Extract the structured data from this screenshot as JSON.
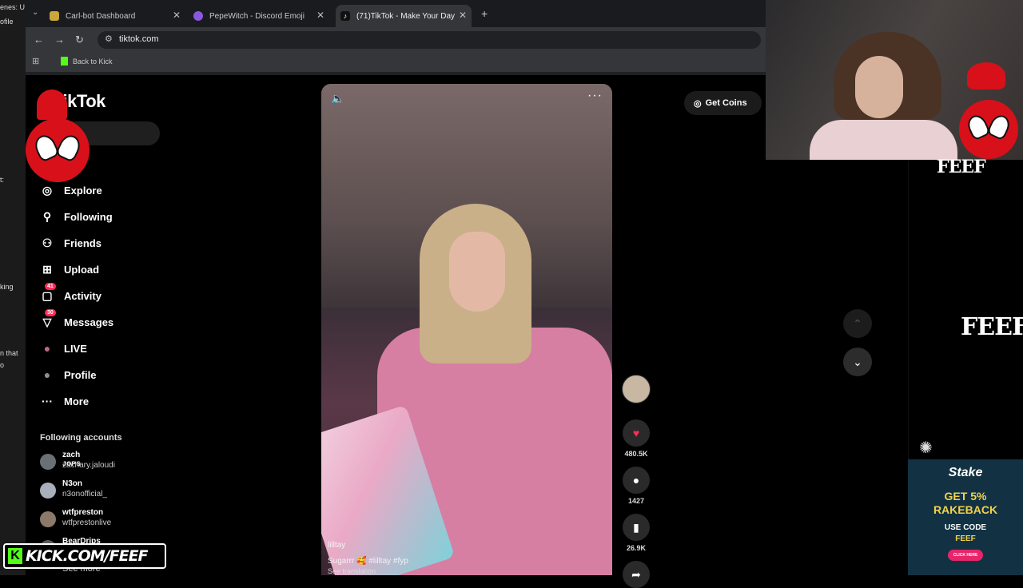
{
  "left_strip": {
    "lines": [
      "enes: U",
      "ofile",
      "t:",
      "king",
      "n that",
      "o"
    ]
  },
  "browser": {
    "tabs": [
      {
        "title": "Carl-bot Dashboard",
        "active": false
      },
      {
        "title": "PepeWitch - Discord Emoji",
        "active": false
      },
      {
        "title": "(71)TikTok - Make Your Day",
        "active": true
      }
    ],
    "new_tab": "+",
    "url": "tiktok.com",
    "bookmark": "Back to Kick"
  },
  "tiktok": {
    "logo": "TikTok",
    "nav": [
      {
        "label": "Explore",
        "icon": "compass-icon",
        "glyph": "◎"
      },
      {
        "label": "Following",
        "icon": "person-follow-icon",
        "glyph": "⚲"
      },
      {
        "label": "Friends",
        "icon": "friends-icon",
        "glyph": "⚇"
      },
      {
        "label": "Upload",
        "icon": "upload-icon",
        "glyph": "⊞"
      },
      {
        "label": "Activity",
        "icon": "activity-icon",
        "glyph": "▢",
        "badge": "41"
      },
      {
        "label": "Messages",
        "icon": "messages-icon",
        "glyph": "▽",
        "badge": "30"
      },
      {
        "label": "LIVE",
        "icon": "live-icon",
        "glyph": "●"
      },
      {
        "label": "Profile",
        "icon": "profile-icon",
        "glyph": "●"
      },
      {
        "label": "More",
        "icon": "more-icon",
        "glyph": "···"
      }
    ],
    "following_header": "Following accounts",
    "following": [
      {
        "name": "zach ᴊᴏᴘs",
        "handle": "zachary.jaloudi"
      },
      {
        "name": "N3on",
        "handle": "n3onofficial_"
      },
      {
        "name": "wtfpreston",
        "handle": "wtfprestonlive"
      },
      {
        "name": "BearDrips",
        "handle": ""
      }
    ],
    "see_more": "See more",
    "get_coins": "Get Coins",
    "video": {
      "author": "lilltay",
      "caption": "Sugarrr 🥰 #lilltay  #fyp",
      "see_translation": "See translation"
    },
    "actions": {
      "likes": "480.5K",
      "comments": "1427",
      "saves": "26.9K"
    }
  },
  "overlay": {
    "feef_text": "FEEF",
    "stake": {
      "logo": "Stake",
      "headline_1": "GET 5%",
      "headline_2": "RAKEBACK",
      "use_code": "USE CODE",
      "code": "FEEF",
      "button": "CLICK HERE"
    },
    "kick_url": "KICK.COM/FEEF"
  },
  "colors": {
    "accent_red": "#fe2c55",
    "kick_green": "#53fc18",
    "stake_gold": "#f3d24a"
  }
}
